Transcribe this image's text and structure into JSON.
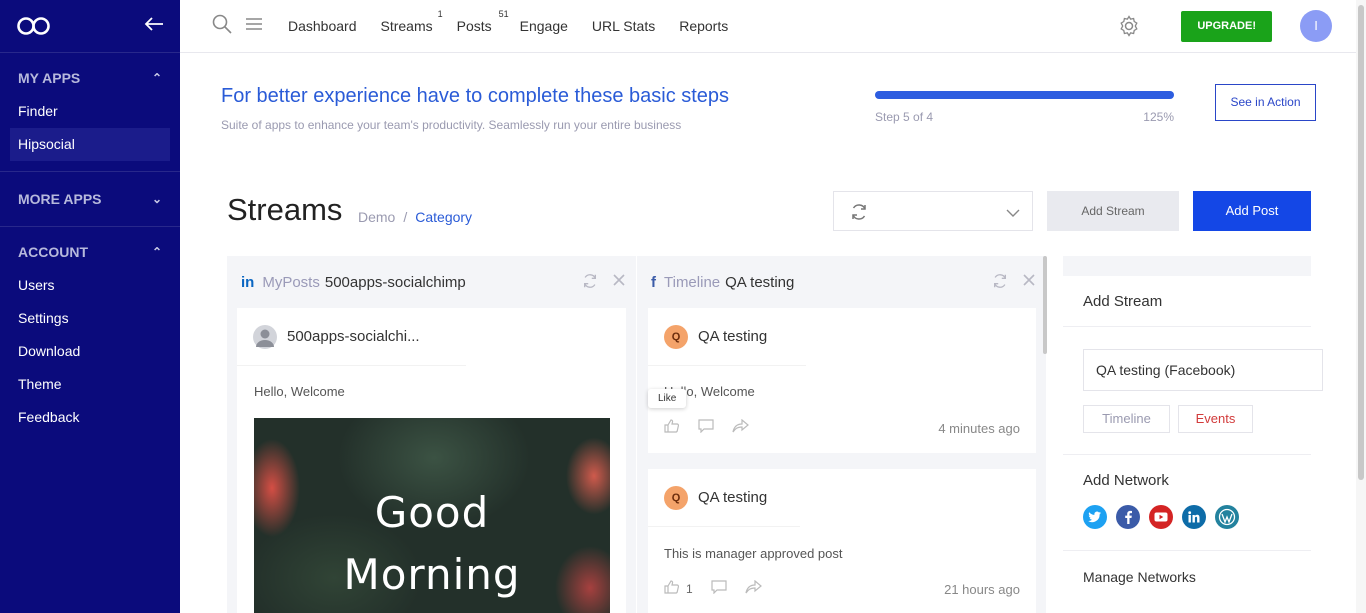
{
  "sidebar": {
    "sections": [
      {
        "title": "MY APPS",
        "items": [
          "Finder",
          "Hipsocial"
        ]
      },
      {
        "title": "MORE APPS",
        "items": []
      },
      {
        "title": "ACCOUNT",
        "items": [
          "Users",
          "Settings",
          "Download",
          "Theme",
          "Feedback"
        ]
      }
    ]
  },
  "nav": {
    "items": [
      "Dashboard",
      "Streams",
      "Posts",
      "Engage",
      "URL Stats",
      "Reports"
    ],
    "streams_count": "1",
    "posts_count": "51",
    "upgrade_label": "UPGRADE!",
    "avatar_initial": "I"
  },
  "onboarding": {
    "title": "For better experience have to complete these basic steps",
    "subtitle": "Suite of apps to enhance your team's productivity. Seamlessly run your entire business",
    "step_text": "Step 5 of 4",
    "percent_text": "125%",
    "progress_fraction": 1.0,
    "see_action_label": "See in Action"
  },
  "streams": {
    "title": "Streams",
    "breadcrumb": [
      "Demo",
      "Category"
    ],
    "add_stream_label": "Add Stream",
    "add_post_label": "Add Post"
  },
  "columns": [
    {
      "network": "in",
      "kind": "MyPosts",
      "name": "500apps-socialchimp",
      "posts": [
        {
          "author": "500apps-socialchi...",
          "text": "Hello, Welcome",
          "image_line1": "Good",
          "image_line2": "Morning"
        }
      ]
    },
    {
      "network": "f",
      "kind": "Timeline",
      "name": "QA testing",
      "posts": [
        {
          "avatar": "Q",
          "author": "QA testing",
          "text": "Hello, Welcome",
          "time": "4 minutes ago"
        },
        {
          "avatar": "Q",
          "author": "QA testing",
          "text": "This is manager approved post",
          "time": "21 hours ago",
          "likes": "1"
        }
      ]
    }
  ],
  "tooltip": "Like",
  "right_panel": {
    "add_stream_title": "Add Stream",
    "account_value": "QA testing (Facebook)",
    "chips": [
      "Timeline",
      "Events"
    ],
    "add_network_title": "Add Network",
    "networks": [
      "twitter",
      "facebook",
      "youtube",
      "linkedin",
      "wordpress"
    ],
    "manage_networks": "Manage Networks"
  },
  "colors": {
    "sidebar_bg": "#0b0b7c",
    "accent": "#2a5bd7",
    "primary_button": "#1447e6",
    "upgrade": "#1aa31a",
    "events": "#d23b3b"
  }
}
